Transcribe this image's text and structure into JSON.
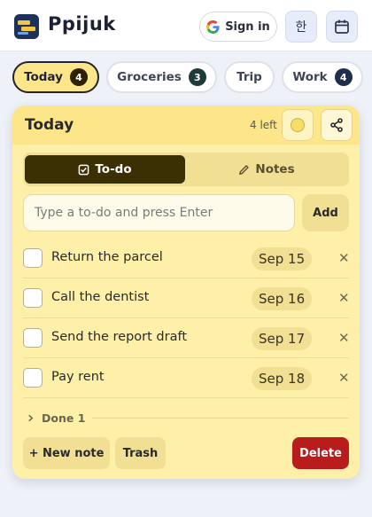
{
  "app": {
    "brand": "Ppijuk"
  },
  "header": {
    "signin_label": "Sign in",
    "lang_label": "한",
    "calendar_icon": "calendar-icon",
    "google_icon": "google-icon"
  },
  "tabs": [
    {
      "label": "Today",
      "count": "4",
      "active": true
    },
    {
      "label": "Groceries",
      "count": "3"
    },
    {
      "label": "Trip"
    },
    {
      "label": "Work",
      "count": "4"
    }
  ],
  "note": {
    "title": "Today",
    "left_count": "4 left",
    "segments": {
      "todo": "To-do",
      "notes": "Notes"
    },
    "input_placeholder": "Type a to-do and press Enter",
    "add_label": "Add",
    "items": [
      {
        "text": "Return the parcel",
        "date": "Sep 15",
        "done": false
      },
      {
        "text": "Call the dentist",
        "date": "Sep 16",
        "done": false
      },
      {
        "text": "Send the report draft",
        "date": "Sep 17",
        "done": false
      },
      {
        "text": "Pay rent",
        "date": "Sep 18",
        "done": false
      }
    ],
    "done_label": "Done 1",
    "new_note_label": "+ New note",
    "trash_label": "Trash",
    "delete_label": "Delete"
  },
  "colors": {
    "note_bg": "#fef0a8",
    "note_header": "#fde68a",
    "accent_dark": "#3b2f04",
    "delete": "#b91c1c",
    "page_bg": "#eef1f8"
  }
}
